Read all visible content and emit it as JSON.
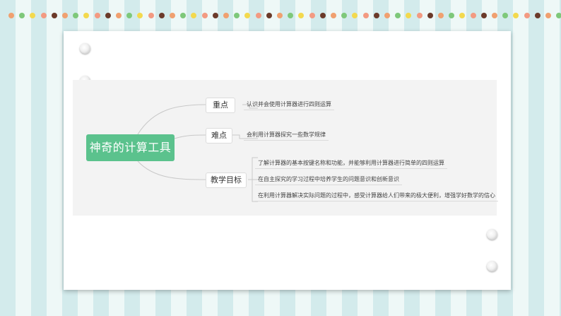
{
  "colors": {
    "stripe_dark": "#d3ebec",
    "stripe_light": "#eef8f7",
    "root_node": "#5bc28d",
    "dot_palette": [
      "#f0a070",
      "#7ec87a",
      "#f3d94e",
      "#f39a82",
      "#6b3a2a"
    ]
  },
  "mindmap": {
    "root": "神奇的计算工具",
    "branches": [
      {
        "label": "重点",
        "items": [
          "认识并会使用计算器进行四则运算"
        ]
      },
      {
        "label": "难点",
        "items": [
          "会利用计算器探究一些数学规律"
        ]
      },
      {
        "label": "教学目标",
        "items": [
          "了解计算器的基本按键名称和功能，并能够利用计算器进行简单的四则运算",
          "在自主探究的学习过程中培养学生的问题意识和创新意识",
          "在利用计算器解决实际问题的过程中，感受计算器给人们带来的极大便利，增强学好数学的信心"
        ]
      }
    ]
  }
}
